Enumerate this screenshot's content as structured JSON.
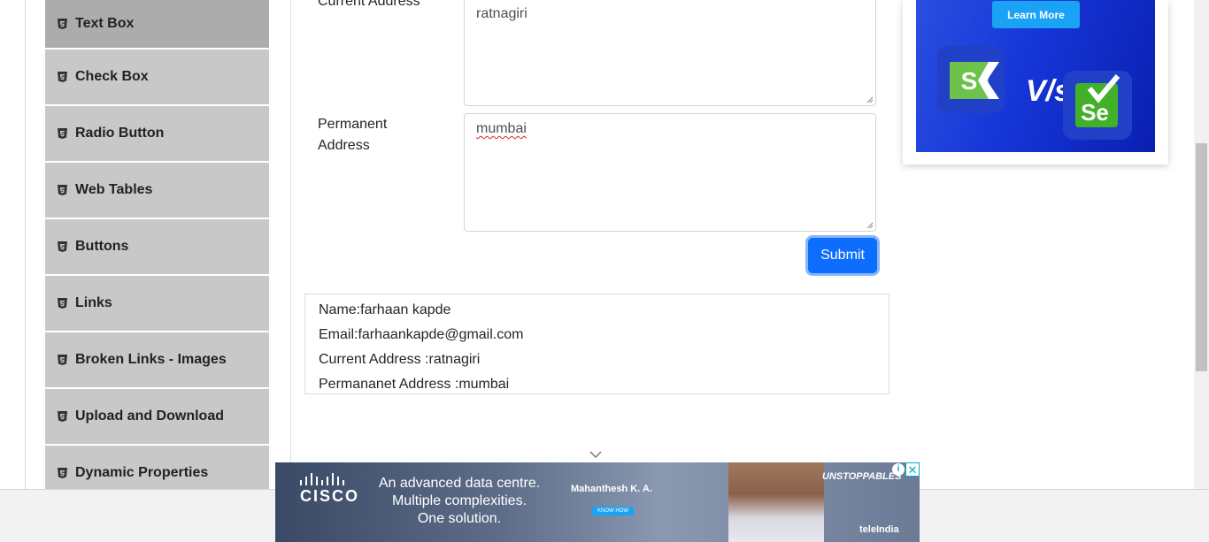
{
  "sidebar": {
    "items": [
      {
        "label": "Text Box"
      },
      {
        "label": "Check Box"
      },
      {
        "label": "Radio Button"
      },
      {
        "label": "Web Tables"
      },
      {
        "label": "Buttons"
      },
      {
        "label": "Links"
      },
      {
        "label": "Broken Links - Images"
      },
      {
        "label": "Upload and Download"
      },
      {
        "label": "Dynamic Properties"
      }
    ]
  },
  "form": {
    "current_address_label": "Current Address",
    "current_address_value": "ratnagiri",
    "permanent_address_label_1": "Permanent",
    "permanent_address_label_2": "Address",
    "permanent_address_value": "mumbai",
    "submit_label": "Submit"
  },
  "output": {
    "name": "Name:farhaan kapde",
    "email": "Email:farhaankapde@gmail.com",
    "current_address": "Current Address :ratnagiri",
    "permanent_address": "Permananet Address :mumbai"
  },
  "right_ad": {
    "cta": "Learn More",
    "vs": "V/s",
    "left_logo": "S",
    "right_logo": "Se"
  },
  "bottom_ad": {
    "brand": "CISCO",
    "tagline_1": "An advanced data centre.",
    "tagline_2": "Multiple complexities.",
    "tagline_3": "One solution.",
    "person_name": "Mahanthesh K. A.",
    "cta": "KNOW HOW",
    "campaign": "UNSTOPPABLES",
    "partner": "teleIndia",
    "close_glyph": "✕",
    "info_glyph": "i"
  }
}
